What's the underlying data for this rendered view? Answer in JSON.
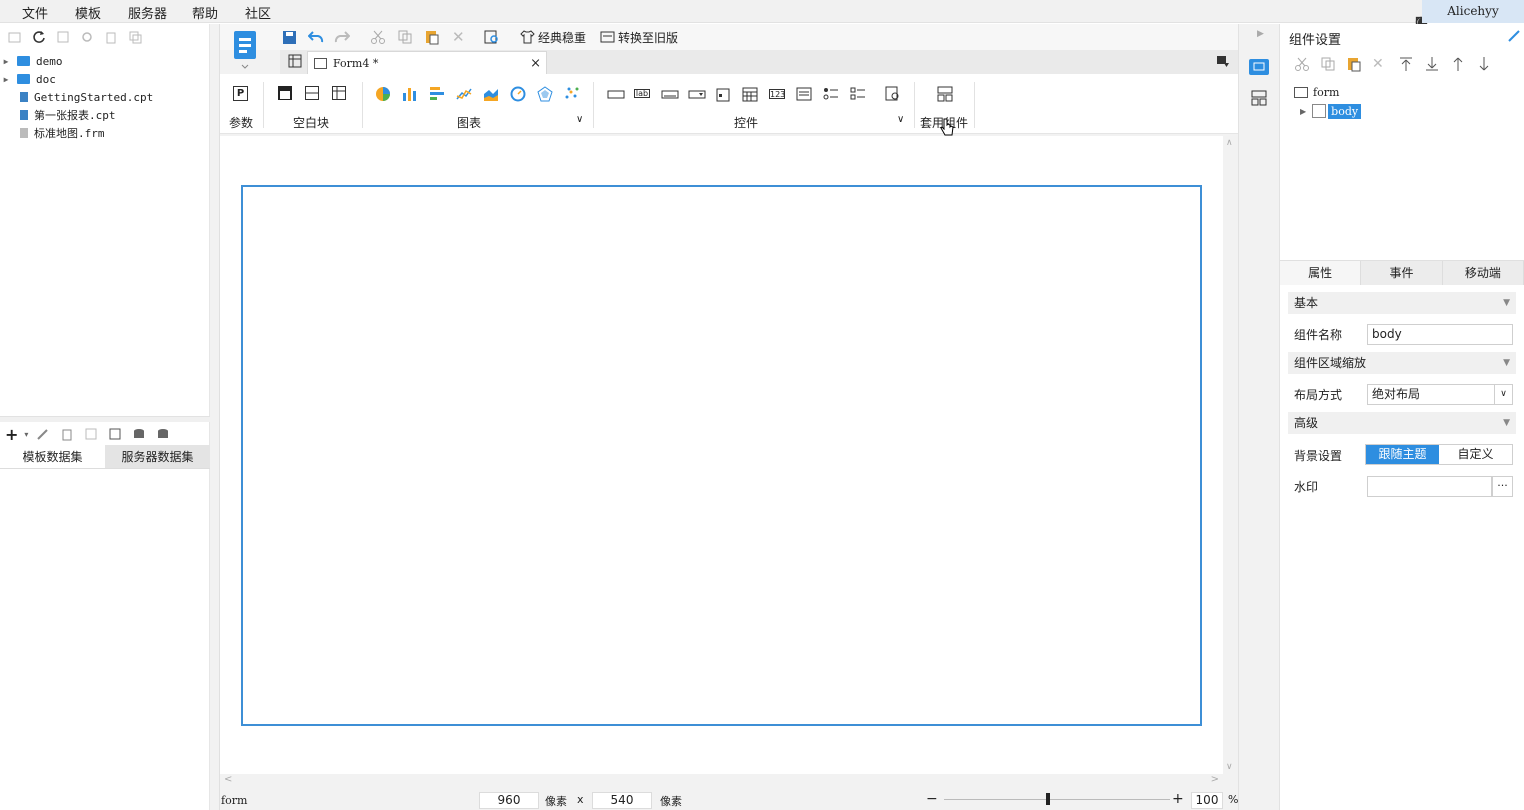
{
  "menu": [
    "文件",
    "模板",
    "服务器",
    "帮助",
    "社区"
  ],
  "user": "Alicehyy",
  "file_tree": [
    {
      "name": "demo",
      "type": "folder"
    },
    {
      "name": "doc",
      "type": "folder"
    },
    {
      "name": "GettingStarted.cpt",
      "type": "file"
    },
    {
      "name": "第一张报表.cpt",
      "type": "file"
    },
    {
      "name": "标准地图.frm",
      "type": "file"
    }
  ],
  "dataset_tabs": [
    "模板数据集",
    "服务器数据集"
  ],
  "toolbar": {
    "classic_label": "经典稳重",
    "convert_label": "转换至旧版"
  },
  "tab": {
    "title": "Form4 *",
    "close": "×"
  },
  "ribbon": {
    "param_label": "参数",
    "blank_label": "空白块",
    "chart_label": "图表",
    "widget_label": "控件",
    "shared_label": "套用组件"
  },
  "statusbar": {
    "left": "form",
    "width": "960",
    "unit1": "像素",
    "x": "x",
    "height": "540",
    "unit2": "像素",
    "minus": "−",
    "plus": "+",
    "zoom": "100",
    "pct": "%"
  },
  "right_panel": {
    "title": "组件设置",
    "tree_root": "form",
    "tree_child": "body",
    "tabs": [
      "属性",
      "事件",
      "移动端"
    ],
    "section_basic": "基本",
    "name_label": "组件名称",
    "name_value": "body",
    "section_scale": "组件区域缩放",
    "layout_label": "布局方式",
    "layout_value": "绝对布局",
    "section_advanced": "高级",
    "bg_label": "背景设置",
    "bg_options": [
      "跟随主题",
      "自定义"
    ],
    "watermark_label": "水印",
    "watermark_btn": "···"
  },
  "colors": {
    "accent": "#2e8ee0",
    "form_border": "#3e8fd6"
  }
}
